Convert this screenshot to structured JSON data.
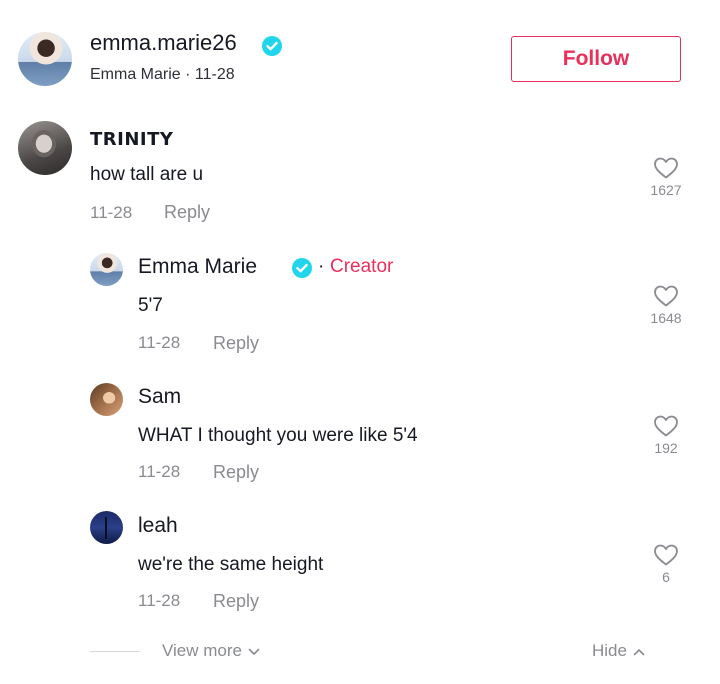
{
  "header": {
    "username": "emma.marie26",
    "meta": "Emma Marie · 11-28",
    "follow_label": "Follow"
  },
  "comment": {
    "username": "TRINITY",
    "text": "how tall are u",
    "date": "11-28",
    "reply_label": "Reply",
    "likes": "1627"
  },
  "replies": [
    {
      "username": "Emma Marie",
      "creator_dot": "·",
      "creator_label": "Creator",
      "text": "5'7",
      "date": "11-28",
      "reply_label": "Reply",
      "likes": "1648"
    },
    {
      "username": "Sam",
      "text": "WHAT I thought you were like 5'4",
      "date": "11-28",
      "reply_label": "Reply",
      "likes": "192"
    },
    {
      "username": "leah",
      "text": "we're the same height",
      "date": "11-28",
      "reply_label": "Reply",
      "likes": "6"
    }
  ],
  "footer": {
    "view_more_label": "View more",
    "hide_label": "Hide"
  },
  "colors": {
    "accent": "#e8305c",
    "verified": "#20d5ec",
    "muted": "#8a8b91"
  },
  "icons": [
    "verified-badge-icon",
    "heart-icon",
    "chevron-down-icon",
    "chevron-up-icon"
  ]
}
